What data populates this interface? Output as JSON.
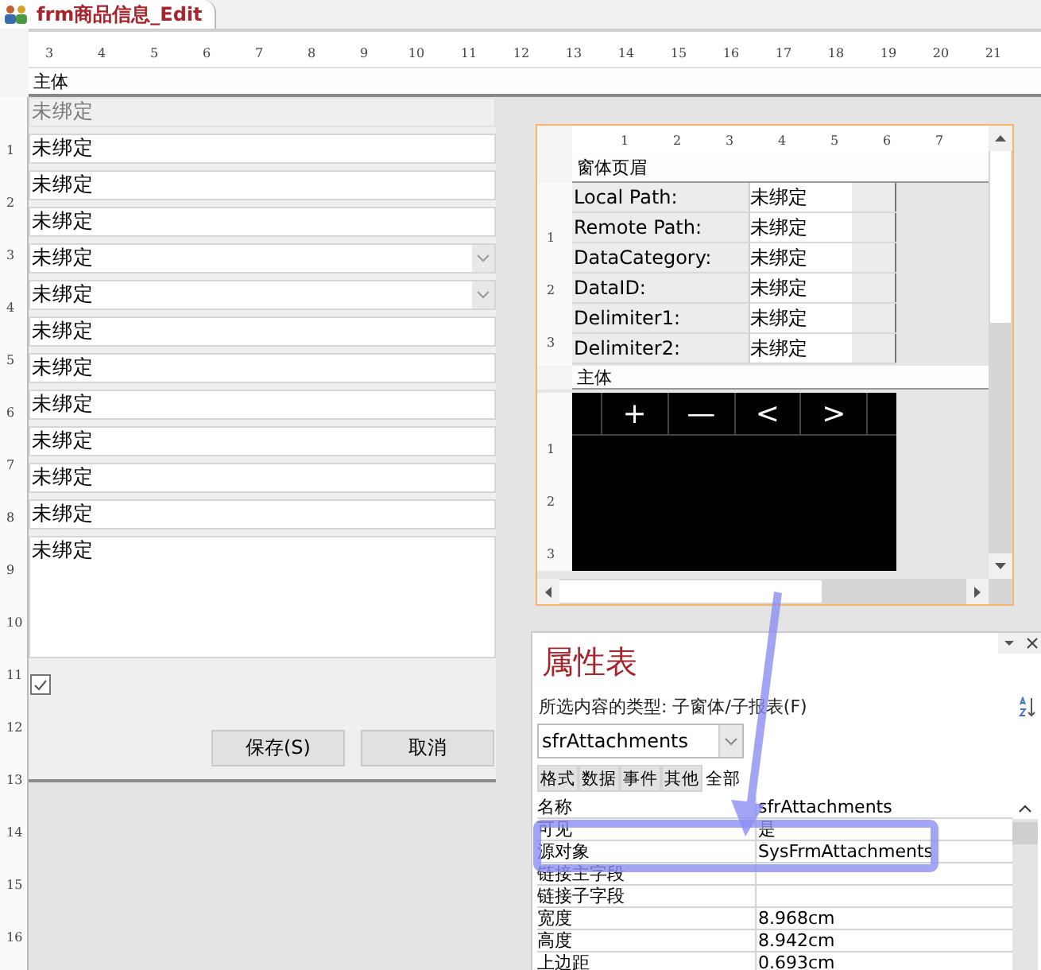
{
  "document_tab": {
    "title": "frm商品信息_Edit"
  },
  "horizontal_ruler": [
    "3",
    "4",
    "5",
    "6",
    "7",
    "8",
    "9",
    "10",
    "11",
    "12",
    "13",
    "14",
    "15",
    "16",
    "17",
    "18",
    "19",
    "20",
    "21"
  ],
  "section": {
    "title": "主体"
  },
  "vertical_ruler": [
    "1",
    "2",
    "3",
    "4",
    "5",
    "6",
    "7",
    "8",
    "9",
    "10",
    "11",
    "12",
    "13",
    "14",
    "15",
    "16"
  ],
  "fields": [
    {
      "kind": "text",
      "value": "未绑定",
      "disabled": true
    },
    {
      "kind": "text",
      "value": "未绑定",
      "disabled": false
    },
    {
      "kind": "text",
      "value": "未绑定",
      "disabled": false
    },
    {
      "kind": "text",
      "value": "未绑定",
      "disabled": false
    },
    {
      "kind": "combo",
      "value": "未绑定",
      "disabled": false
    },
    {
      "kind": "combo",
      "value": "未绑定",
      "disabled": false
    },
    {
      "kind": "text",
      "value": "未绑定",
      "disabled": false
    },
    {
      "kind": "text",
      "value": "未绑定",
      "disabled": false
    },
    {
      "kind": "text",
      "value": "未绑定",
      "disabled": false
    },
    {
      "kind": "text",
      "value": "未绑定",
      "disabled": false
    },
    {
      "kind": "text",
      "value": "未绑定",
      "disabled": false
    },
    {
      "kind": "text",
      "value": "未绑定",
      "disabled": false
    },
    {
      "kind": "memo",
      "value": "未绑定",
      "disabled": false
    }
  ],
  "checkbox": {
    "checked": true
  },
  "buttons": [
    "保存(S)",
    "取消"
  ],
  "subform": {
    "ruler": [
      "1",
      "2",
      "3",
      "4",
      "5",
      "6",
      "7"
    ],
    "header_ruler": [
      "1",
      "2",
      "3"
    ],
    "header_title": "窗体页眉",
    "rows": [
      {
        "label": "Local Path:",
        "value": "未绑定"
      },
      {
        "label": "Remote Path:",
        "value": "未绑定"
      },
      {
        "label": "DataCategory:",
        "value": "未绑定"
      },
      {
        "label": "DataID:",
        "value": "未绑定"
      },
      {
        "label": "Delimiter1:",
        "value": "未绑定"
      },
      {
        "label": "Delimiter2:",
        "value": "未绑定"
      }
    ],
    "detail_title": "主体",
    "detail_ruler": [
      "1",
      "2",
      "3"
    ],
    "nav_buttons": [
      "+",
      "—",
      "<",
      ">"
    ]
  },
  "property_sheet": {
    "title": "属性表",
    "selection_type": "所选内容的类型:  子窗体/子报表(F)",
    "object": "sfrAttachments",
    "tabs": [
      {
        "label": "格式",
        "selected": false
      },
      {
        "label": "数据",
        "selected": false
      },
      {
        "label": "事件",
        "selected": false
      },
      {
        "label": "其他",
        "selected": false
      },
      {
        "label": "全部",
        "selected": true
      }
    ],
    "properties": [
      {
        "name": "名称",
        "value": "sfrAttachments"
      },
      {
        "name": "可见",
        "value": "是"
      },
      {
        "name": "源对象",
        "value": "SysFrmAttachments"
      },
      {
        "name": "链接主字段"
      },
      {
        "name": "链接子字段"
      },
      {
        "name": "宽度",
        "value": "8.968cm"
      },
      {
        "name": "高度",
        "value": "8.942cm"
      },
      {
        "name": "上边距",
        "value": "0.693cm"
      }
    ]
  }
}
